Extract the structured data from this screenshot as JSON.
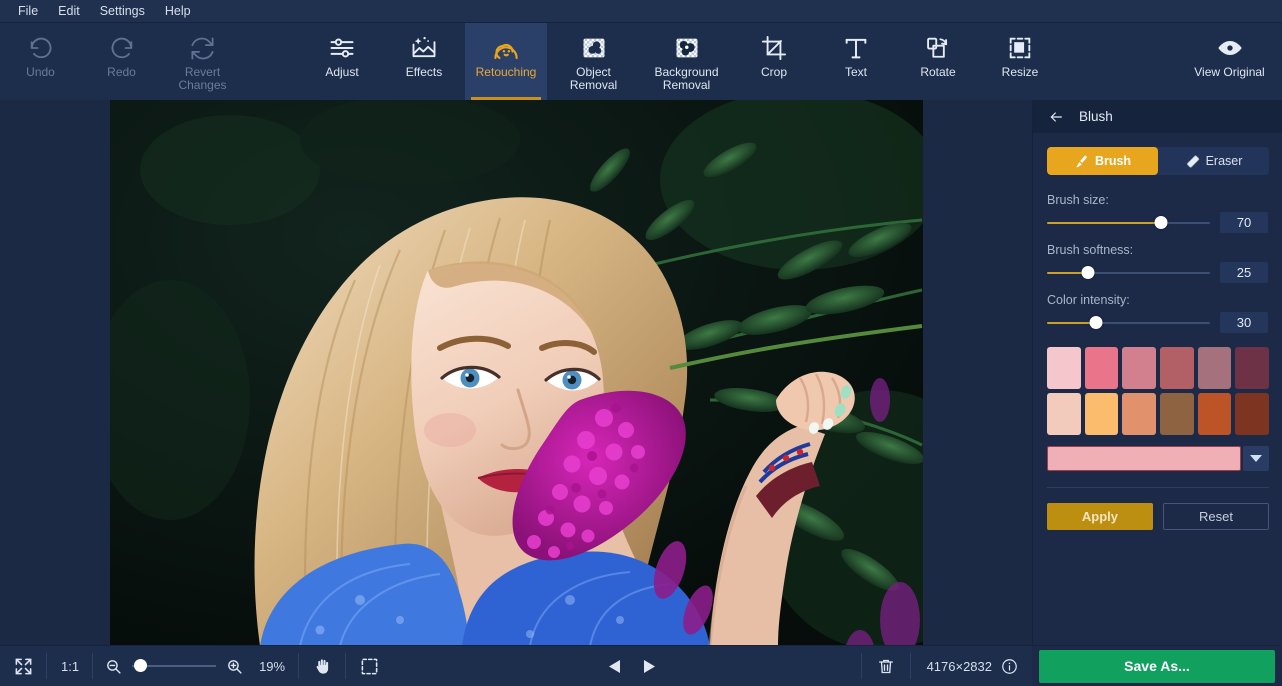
{
  "menubar": {
    "items": [
      {
        "label": "File"
      },
      {
        "label": "Edit"
      },
      {
        "label": "Settings"
      },
      {
        "label": "Help"
      }
    ]
  },
  "toolbar": {
    "tools": [
      {
        "name": "undo",
        "label": "Undo",
        "icon": "undo-icon",
        "state": "disabled"
      },
      {
        "name": "redo",
        "label": "Redo",
        "icon": "redo-icon",
        "state": "disabled"
      },
      {
        "name": "revert-changes",
        "label": "Revert Changes",
        "icon": "revert-icon",
        "state": "disabled"
      },
      {
        "name": "adjust",
        "label": "Adjust",
        "icon": "sliders-icon",
        "state": "normal"
      },
      {
        "name": "effects",
        "label": "Effects",
        "icon": "sparkle-image-icon",
        "state": "normal"
      },
      {
        "name": "retouching",
        "label": "Retouching",
        "icon": "face-icon",
        "state": "active"
      },
      {
        "name": "object-removal",
        "label": "Object Removal",
        "icon": "object-removal-icon",
        "state": "normal"
      },
      {
        "name": "background-removal",
        "label": "Background Removal",
        "icon": "background-removal-icon",
        "state": "normal"
      },
      {
        "name": "crop",
        "label": "Crop",
        "icon": "crop-icon",
        "state": "normal"
      },
      {
        "name": "text",
        "label": "Text",
        "icon": "text-icon",
        "state": "normal"
      },
      {
        "name": "rotate",
        "label": "Rotate",
        "icon": "rotate-icon",
        "state": "normal"
      },
      {
        "name": "resize",
        "label": "Resize",
        "icon": "resize-icon",
        "state": "normal"
      }
    ],
    "view_original": {
      "label": "View Original",
      "icon": "eye-icon"
    }
  },
  "panel": {
    "back_icon": "back-arrow-icon",
    "title": "Blush",
    "mode_toggle": {
      "brush": {
        "label": "Brush",
        "icon": "brush-icon",
        "selected": true
      },
      "eraser": {
        "label": "Eraser",
        "icon": "eraser-icon",
        "selected": false
      }
    },
    "sliders": [
      {
        "name": "brush-size",
        "label": "Brush size:",
        "value": "70",
        "percent": 70
      },
      {
        "name": "brush-softness",
        "label": "Brush softness:",
        "value": "25",
        "percent": 25
      },
      {
        "name": "color-intensity",
        "label": "Color intensity:",
        "value": "30",
        "percent": 30
      }
    ],
    "swatches": [
      {
        "name": "swatch-1",
        "color": "#f6c6cd"
      },
      {
        "name": "swatch-2",
        "color": "#ea7489"
      },
      {
        "name": "swatch-3",
        "color": "#d3808e"
      },
      {
        "name": "swatch-4",
        "color": "#b35f66"
      },
      {
        "name": "swatch-5",
        "color": "#a5717c"
      },
      {
        "name": "swatch-6",
        "color": "#6e3247"
      },
      {
        "name": "swatch-7",
        "color": "#f2cbbd"
      },
      {
        "name": "swatch-8",
        "color": "#fcbc6e"
      },
      {
        "name": "swatch-9",
        "color": "#e1926c"
      },
      {
        "name": "swatch-10",
        "color": "#8d6342"
      },
      {
        "name": "swatch-11",
        "color": "#bc5427"
      },
      {
        "name": "swatch-12",
        "color": "#7d3521"
      }
    ],
    "selected_color": {
      "color": "#f0aeb5",
      "border": "#9e3d4e",
      "dropdown_icon": "chevron-down-icon"
    },
    "apply_label": "Apply",
    "reset_label": "Reset"
  },
  "bottombar": {
    "fit_icon": "fit-screen-icon",
    "one_to_one": "1:1",
    "zoom_out_icon": "zoom-out-icon",
    "zoom_in_icon": "zoom-in-icon",
    "zoom_level": "19%",
    "zoom_percent": 10,
    "hand_icon": "hand-tool-icon",
    "select_icon": "marquee-select-icon",
    "prev_icon": "prev-triangle-icon",
    "next_icon": "next-triangle-icon",
    "trash_icon": "trash-icon",
    "dimensions": "4176×2832",
    "info_icon": "info-icon",
    "save_as_label": "Save As..."
  },
  "colors": {
    "accent_gold": "#e8a61e",
    "accent_green": "#12a05e",
    "panel_bg": "#1c2a47",
    "toolbar_bg": "#1d2d4c",
    "menubar_bg": "#20314f"
  }
}
